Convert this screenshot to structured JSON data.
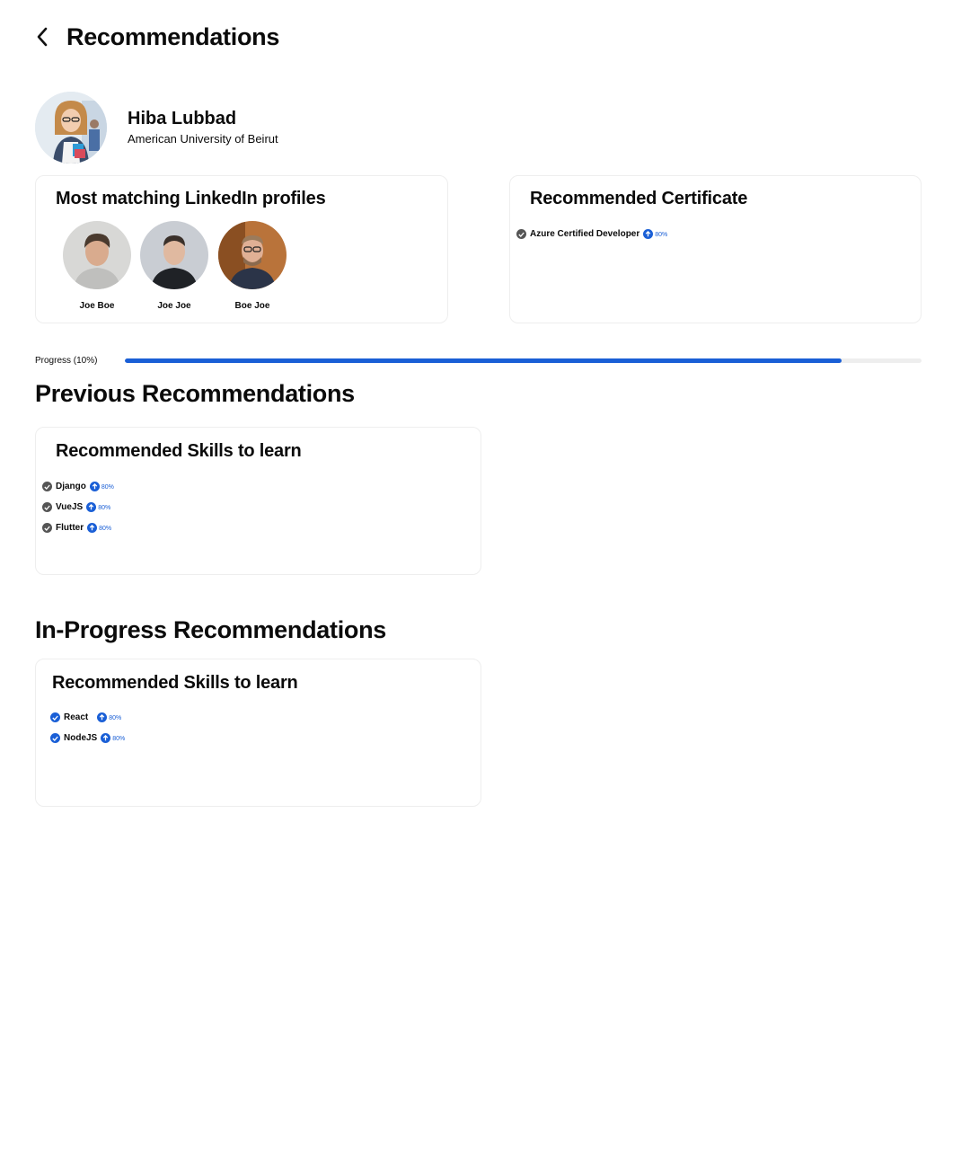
{
  "header": {
    "title": "Recommendations",
    "back_icon": "chevron-left-icon"
  },
  "profile": {
    "name": "Hiba Lubbad",
    "university": "American University of Beirut"
  },
  "linkedin": {
    "title": "Most  matching LinkedIn profiles",
    "people": [
      {
        "name": "Joe Boe"
      },
      {
        "name": "Joe Joe"
      },
      {
        "name": "Boe Joe"
      }
    ]
  },
  "certificate": {
    "title": "Recommended Certificate",
    "items": [
      {
        "label": "Azure Certified Developer",
        "percent": "80%"
      }
    ]
  },
  "progress": {
    "label": "Progress (10%)",
    "fill_fraction": 0.9,
    "color": "#1a5fd6"
  },
  "previous": {
    "section_title": "Previous Recommendations",
    "card_title": "Recommended Skills to learn",
    "items": [
      {
        "label": "Django",
        "percent": "80%"
      },
      {
        "label": "VueJS",
        "percent": "80%"
      },
      {
        "label": "Flutter",
        "percent": "80%"
      }
    ]
  },
  "in_progress": {
    "section_title": "In-Progress Recommendations",
    "card_title": "Recommended Skills to learn",
    "items": [
      {
        "label": "React",
        "percent": "80%"
      },
      {
        "label": "NodeJS",
        "percent": "80%"
      }
    ]
  },
  "colors": {
    "accent": "#1a5fd6",
    "done_check": "#555555",
    "card_border": "#eeeeee"
  }
}
